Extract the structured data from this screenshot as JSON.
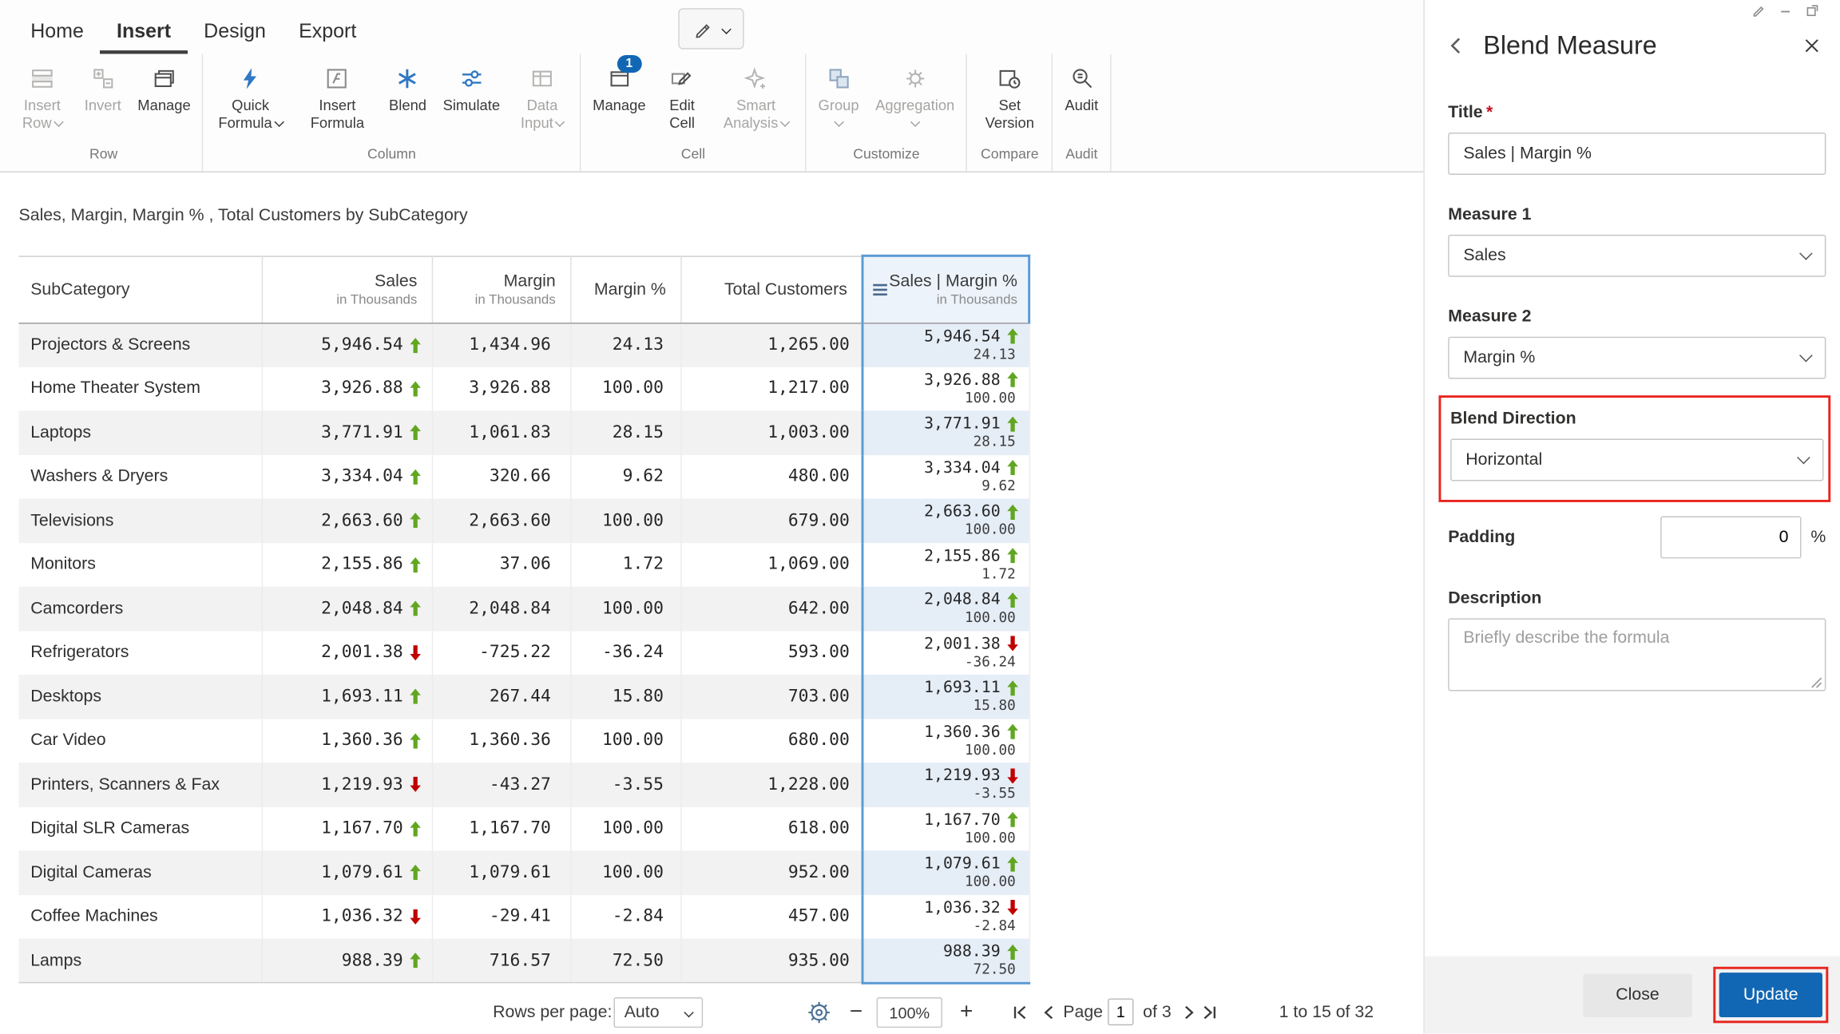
{
  "colors": {
    "accent": "#1267b4",
    "positive": "#61a620",
    "negative": "#c00000",
    "blend_border": "#5b9bd5",
    "annotation": "#e8251f"
  },
  "ribbon": {
    "tabs": [
      "Home",
      "Insert",
      "Design",
      "Export"
    ],
    "active_tab": "Insert",
    "groups": [
      {
        "label": "Row",
        "buttons": [
          {
            "label": "Insert Row",
            "disabled": true,
            "chevron": true
          },
          {
            "label": "Invert",
            "disabled": true
          },
          {
            "label": "Manage"
          }
        ]
      },
      {
        "label": "Column",
        "buttons": [
          {
            "label": "Quick Formula",
            "chevron": true
          },
          {
            "label": "Insert Formula"
          },
          {
            "label": "Blend"
          },
          {
            "label": "Simulate"
          },
          {
            "label": "Data Input",
            "disabled": true,
            "chevron": true
          }
        ]
      },
      {
        "label": "Cell",
        "buttons": [
          {
            "label": "Manage",
            "badge": "1"
          },
          {
            "label": "Edit Cell"
          },
          {
            "label": "Smart Analysis",
            "disabled": true,
            "chevron": true
          }
        ]
      },
      {
        "label": "Customize",
        "buttons": [
          {
            "label": "Group",
            "disabled": true,
            "chevron": true
          },
          {
            "label": "Aggregation",
            "disabled": true,
            "chevron": true
          }
        ]
      },
      {
        "label": "Compare",
        "buttons": [
          {
            "label": "Set Version"
          }
        ]
      },
      {
        "label": "Audit",
        "buttons": [
          {
            "label": "Audit"
          }
        ]
      }
    ]
  },
  "table": {
    "title": "Sales, Margin, Margin % , Total Customers by SubCategory",
    "columns": [
      {
        "name": "SubCategory"
      },
      {
        "name": "Sales",
        "sub": "in Thousands"
      },
      {
        "name": "Margin",
        "sub": "in Thousands"
      },
      {
        "name": "Margin %"
      },
      {
        "name": "Total Customers"
      },
      {
        "name": "Sales | Margin %",
        "sub": "in Thousands",
        "selected": true
      }
    ],
    "rows": [
      {
        "name": "Projectors & Screens",
        "sales": "5,946.54",
        "dir": "up",
        "margin": "1,434.96",
        "pct": "24.13",
        "customers": "1,265.00"
      },
      {
        "name": "Home Theater System",
        "sales": "3,926.88",
        "dir": "up",
        "margin": "3,926.88",
        "pct": "100.00",
        "customers": "1,217.00"
      },
      {
        "name": "Laptops",
        "sales": "3,771.91",
        "dir": "up",
        "margin": "1,061.83",
        "pct": "28.15",
        "customers": "1,003.00"
      },
      {
        "name": "Washers & Dryers",
        "sales": "3,334.04",
        "dir": "up",
        "margin": "320.66",
        "pct": "9.62",
        "customers": "480.00"
      },
      {
        "name": "Televisions",
        "sales": "2,663.60",
        "dir": "up",
        "margin": "2,663.60",
        "pct": "100.00",
        "customers": "679.00"
      },
      {
        "name": "Monitors",
        "sales": "2,155.86",
        "dir": "up",
        "margin": "37.06",
        "pct": "1.72",
        "customers": "1,069.00"
      },
      {
        "name": "Camcorders",
        "sales": "2,048.84",
        "dir": "up",
        "margin": "2,048.84",
        "pct": "100.00",
        "customers": "642.00"
      },
      {
        "name": "Refrigerators",
        "sales": "2,001.38",
        "dir": "down",
        "margin": "-725.22",
        "pct": "-36.24",
        "customers": "593.00"
      },
      {
        "name": "Desktops",
        "sales": "1,693.11",
        "dir": "up",
        "margin": "267.44",
        "pct": "15.80",
        "customers": "703.00"
      },
      {
        "name": "Car Video",
        "sales": "1,360.36",
        "dir": "up",
        "margin": "1,360.36",
        "pct": "100.00",
        "customers": "680.00"
      },
      {
        "name": "Printers, Scanners & Fax",
        "sales": "1,219.93",
        "dir": "down",
        "margin": "-43.27",
        "pct": "-3.55",
        "customers": "1,228.00"
      },
      {
        "name": "Digital SLR Cameras",
        "sales": "1,167.70",
        "dir": "up",
        "margin": "1,167.70",
        "pct": "100.00",
        "customers": "618.00"
      },
      {
        "name": "Digital Cameras",
        "sales": "1,079.61",
        "dir": "up",
        "margin": "1,079.61",
        "pct": "100.00",
        "customers": "952.00"
      },
      {
        "name": "Coffee Machines",
        "sales": "1,036.32",
        "dir": "down",
        "margin": "-29.41",
        "pct": "-2.84",
        "customers": "457.00"
      },
      {
        "name": "Lamps",
        "sales": "988.39",
        "dir": "up",
        "margin": "716.57",
        "pct": "72.50",
        "customers": "935.00"
      }
    ]
  },
  "footer": {
    "rows_per_page_label": "Rows per page:",
    "rows_per_page_value": "Auto",
    "zoom_out": "−",
    "zoom": "100%",
    "zoom_in": "+",
    "page_label": "Page",
    "page_value": "1",
    "of_label": "of 3",
    "range": "1 to 15 of 32"
  },
  "panel": {
    "title": "Blend Measure",
    "fields": {
      "title_label": "Title",
      "required_mark": "*",
      "title_value": "Sales | Margin %",
      "measure1_label": "Measure 1",
      "measure1_value": "Sales",
      "measure2_label": "Measure 2",
      "measure2_value": "Margin %",
      "blend_direction_label": "Blend Direction",
      "blend_direction_value": "Horizontal",
      "padding_label": "Padding",
      "padding_value": "0",
      "padding_unit": "%",
      "description_label": "Description",
      "description_placeholder": "Briefly describe the formula"
    },
    "buttons": {
      "close": "Close",
      "update": "Update"
    }
  }
}
